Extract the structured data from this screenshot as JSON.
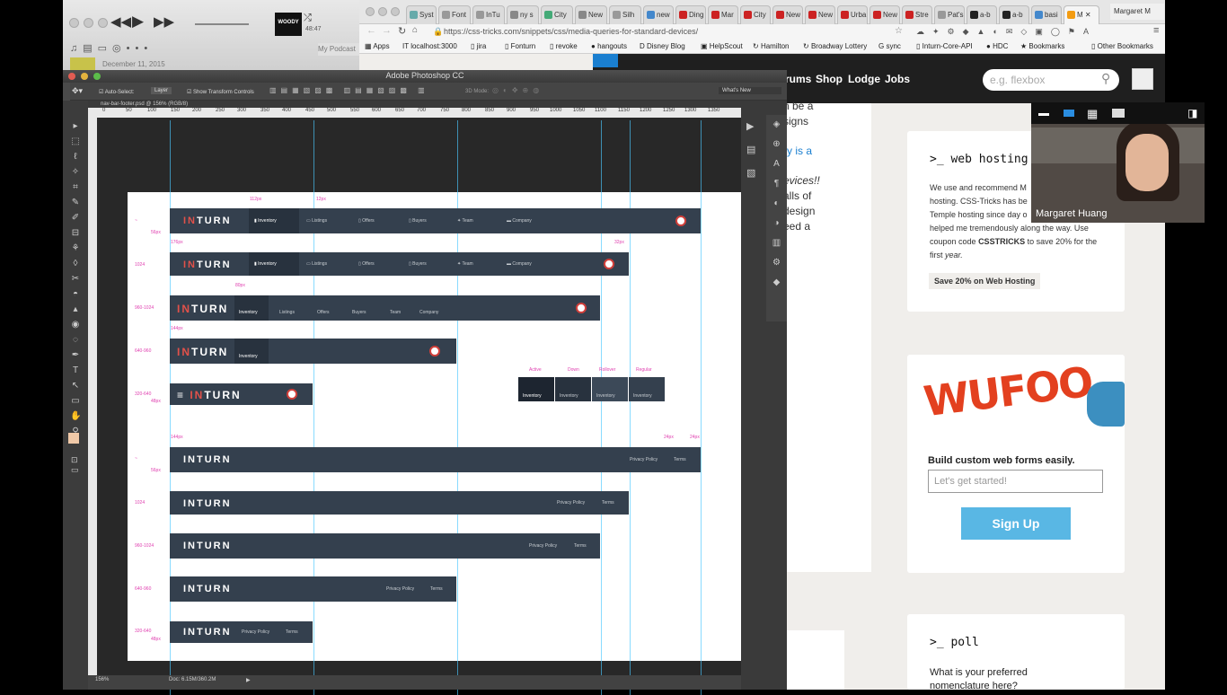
{
  "itunes": {
    "time": "48:47",
    "date": "December 11, 2015",
    "podcasts": "My Podcast",
    "album": "WOODY"
  },
  "chrome": {
    "tabs": [
      "Syst",
      "Font",
      "InTu",
      "ny s",
      "City",
      "New",
      "Silh",
      "new",
      "Ding",
      "Mar",
      "City",
      "New",
      "New",
      "Urba",
      "New",
      "Stre",
      "Pat's",
      "a-b",
      "a-b",
      "basi",
      "M"
    ],
    "user": "Margaret M",
    "url": "https://css-tricks.com/snippets/css/media-queries-for-standard-devices/",
    "bookmarks": [
      "Apps",
      "localhost:3000",
      "jira",
      "Fonturn",
      "revoke",
      "hangouts",
      "Disney Blog",
      "HelpScout",
      "Hamilton",
      "Broadway Lottery",
      "sync",
      "Inturn-Core-API",
      "HDC",
      "Bookmarks",
      "Other Bookmarks"
    ]
  },
  "site": {
    "nav": [
      "rums",
      "Shop",
      "Lodge",
      "Jobs"
    ],
    "search_placeholder": "e.g. flexbox",
    "snippets": [
      "n be a",
      "signs",
      "ry is a",
      "evices!!",
      "alls of",
      "design",
      "eed a"
    ],
    "hosting": {
      "title": ">_ web hosting",
      "body1": "We use and recommend M",
      "body2": "hosting. CSS-Tricks has be",
      "body3": "Temple hosting since day o",
      "body4": "helped me tremendously along the way. Use",
      "body5": "coupon code",
      "code": "CSSTRICKS",
      "body6": "to save 20% for the",
      "body7": "first",
      "em": "year.",
      "button": "Save 20% on Web Hosting"
    },
    "wufoo": {
      "logo": "WUFOO",
      "tag": "Build custom web forms easily.",
      "placeholder": "Let's get started!",
      "button": "Sign Up"
    },
    "poll": {
      "title": ">_ poll",
      "q1": "What is your preferred",
      "q2": "nomenclature here?"
    }
  },
  "webcam": {
    "name": "Margaret Huang"
  },
  "photoshop": {
    "title": "Adobe Photoshop CC",
    "doc_tab": "nav-bar-footer.psd @ 156% (RGB/8)",
    "options": {
      "auto_select": "Auto-Select:",
      "layer": "Layer",
      "transform": "Show Transform Controls",
      "mode3d": "3D Mode:",
      "workspace": "What's New"
    },
    "ruler": [
      "0",
      "50",
      "100",
      "150",
      "200",
      "250",
      "300",
      "350",
      "400",
      "450",
      "500",
      "550",
      "600",
      "650",
      "700",
      "750",
      "800",
      "850",
      "900",
      "950",
      "1000",
      "1050",
      "1100",
      "1150",
      "1200",
      "1250",
      "1300",
      "1350"
    ],
    "status": {
      "zoom": "156%",
      "doc": "Doc: 6.15M/360.2M"
    },
    "logo_a": "IN",
    "logo_b": "TURN",
    "nav_items": [
      "Inventory",
      "Listings",
      "Offers",
      "Buyers",
      "Team",
      "Company"
    ],
    "footer_links": [
      "Privacy Policy",
      "Terms"
    ],
    "breakpoints": [
      "~",
      "1024",
      "960-1024",
      "640-960",
      "320-640"
    ],
    "heights": [
      "56px",
      "48px"
    ],
    "measures": {
      "m1": "112px",
      "m2": "12px",
      "m3": "176px",
      "m4": "32px",
      "m5": "80px",
      "m6": "144px",
      "m7": "144px",
      "m8": "24px",
      "m9": "24px"
    },
    "states": [
      "Active",
      "Down",
      "Rollover",
      "Regular"
    ]
  }
}
